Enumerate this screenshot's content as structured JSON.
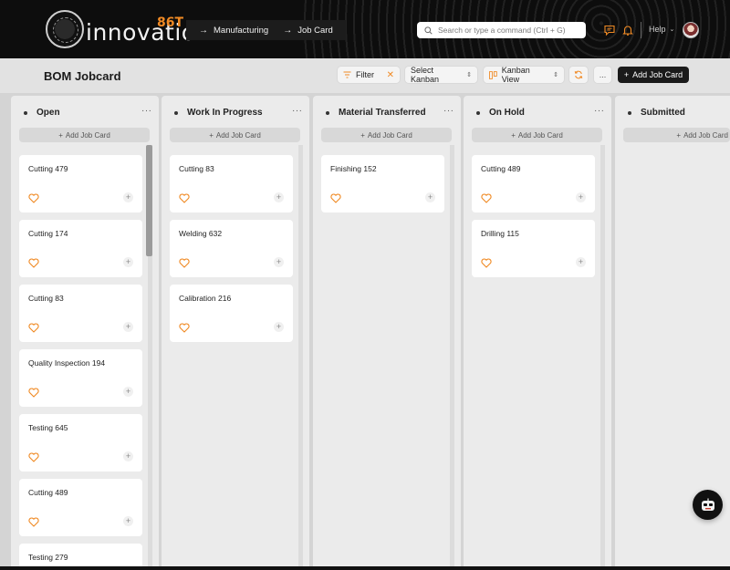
{
  "brand": {
    "logo_text": "innovation",
    "logo_number": "86T",
    "accent": "#f08a24"
  },
  "breadcrumbs": [
    {
      "label": "Manufacturing"
    },
    {
      "label": "Job Card"
    }
  ],
  "search": {
    "placeholder": "Search or type a command (Ctrl + G)"
  },
  "navbar": {
    "help_label": "Help"
  },
  "page": {
    "title": "BOM Jobcard"
  },
  "toolbar": {
    "filter_label": "Filter",
    "select_kanban_label": "Select Kanban",
    "kanban_view_label": "Kanban View",
    "more_label": "...",
    "add_job_card_label": "Add Job Card"
  },
  "board": {
    "add_card_label": "Add Job Card",
    "columns": [
      {
        "title": "Open",
        "cards": [
          {
            "title": "Cutting 479"
          },
          {
            "title": "Cutting 174"
          },
          {
            "title": "Cutting 83"
          },
          {
            "title": "Quality Inspection 194"
          },
          {
            "title": "Testing 645"
          },
          {
            "title": "Cutting 489"
          },
          {
            "title": "Testing 279"
          }
        ]
      },
      {
        "title": "Work In Progress",
        "cards": [
          {
            "title": "Cutting 83"
          },
          {
            "title": "Welding 632"
          },
          {
            "title": "Calibration 216"
          }
        ]
      },
      {
        "title": "Material Transferred",
        "cards": [
          {
            "title": "Finishing 152"
          }
        ]
      },
      {
        "title": "On Hold",
        "cards": [
          {
            "title": "Cutting 489"
          },
          {
            "title": "Drilling 115"
          }
        ]
      },
      {
        "title": "Submitted",
        "cards": []
      }
    ]
  }
}
